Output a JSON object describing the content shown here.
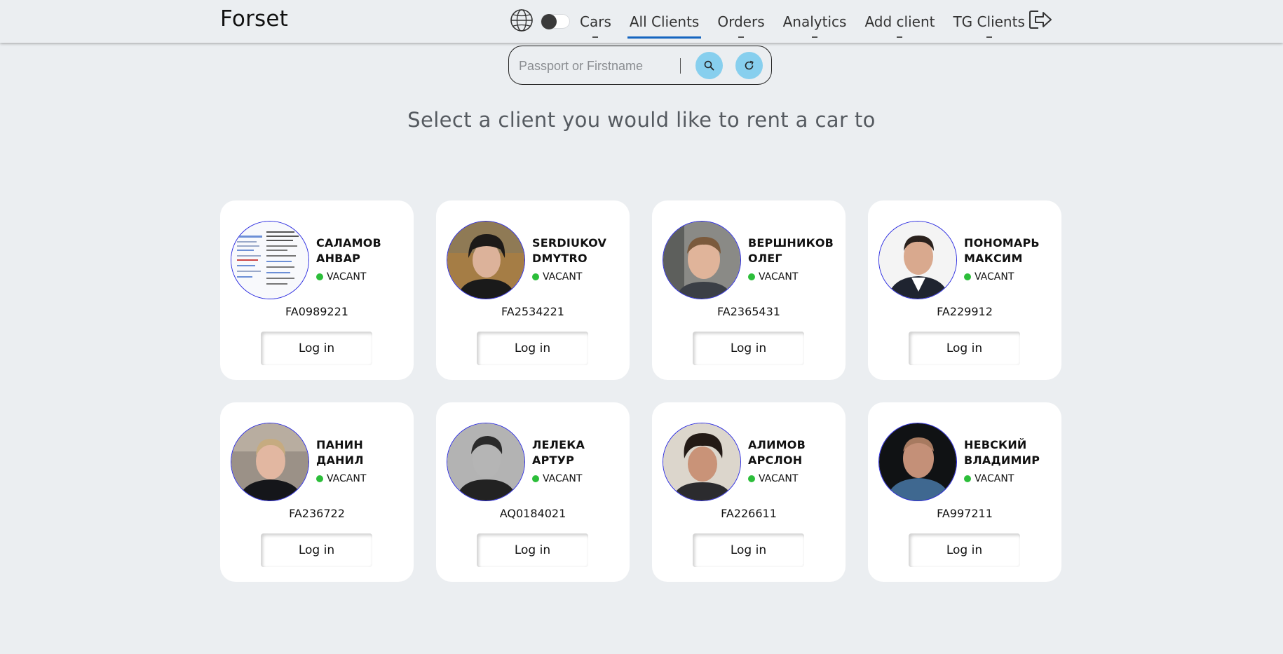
{
  "header": {
    "brand": "Forset",
    "nav": [
      {
        "label": "Cars",
        "active": false
      },
      {
        "label": "All Clients",
        "active": true
      },
      {
        "label": "Orders",
        "active": false
      },
      {
        "label": "Analytics",
        "active": false
      },
      {
        "label": "Add client",
        "active": false
      },
      {
        "label": "TG Clients",
        "active": false
      }
    ]
  },
  "search": {
    "placeholder": "Passport or Firstname",
    "value": ""
  },
  "heading": "Select a client you would like to rent a car to",
  "clients": [
    {
      "last": "САЛАМОВ",
      "first": "АНВАР",
      "status": "VACANT",
      "passport": "FA0989221",
      "login": "Log in"
    },
    {
      "last": "SERDIUKOV",
      "first": "DMYTRO",
      "status": "VACANT",
      "passport": "FA2534221",
      "login": "Log in"
    },
    {
      "last": "ВЕРШНИКОВ",
      "first": "ОЛЕГ",
      "status": "VACANT",
      "passport": "FA2365431",
      "login": "Log in"
    },
    {
      "last": "ПОНОМАРЬ",
      "first": "МАКСИМ",
      "status": "VACANT",
      "passport": "FA229912",
      "login": "Log in"
    },
    {
      "last": "ПАНИН",
      "first": "ДАНИЛ",
      "status": "VACANT",
      "passport": "FA236722",
      "login": "Log in"
    },
    {
      "last": "ЛЕЛЕКА",
      "first": "АРТУР",
      "status": "VACANT",
      "passport": "AQ0184021",
      "login": "Log in"
    },
    {
      "last": "АЛИМОВ",
      "first": "АРСЛОН",
      "status": "VACANT",
      "passport": "FA226611",
      "login": "Log in"
    },
    {
      "last": "НЕВСКИЙ",
      "first": "ВЛАДИМИР",
      "status": "VACANT",
      "passport": "FA997211",
      "login": "Log in"
    }
  ],
  "colors": {
    "active_nav": "#1565c0",
    "status_vacant": "#2cbe3a",
    "action_button": "#87cfee",
    "avatar_border": "#2b2be0"
  },
  "icons": {
    "language": "globe-icon",
    "theme": "theme-toggle",
    "logout": "logout-icon",
    "search": "search-icon",
    "refresh": "refresh-icon"
  }
}
